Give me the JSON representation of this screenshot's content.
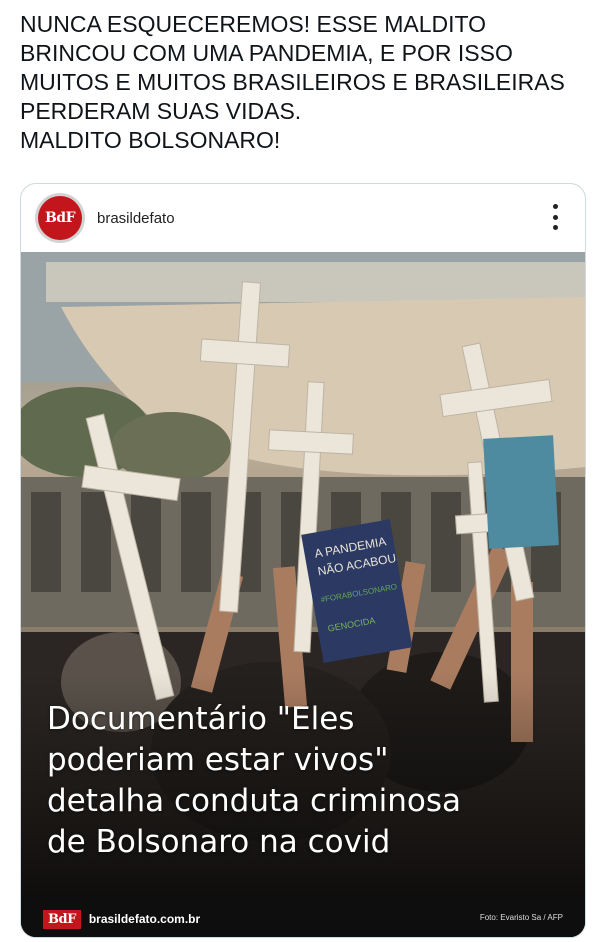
{
  "tweet": {
    "lines": [
      "NUNCA ESQUECEREMOS! ESSE MALDITO",
      "BRINCOU COM UMA PANDEMIA, E POR ISSO",
      "MUITOS E MUITOS BRASILEIROS E BRASILEIRAS",
      "PERDERAM SUAS VIDAS.",
      "MALDITO BOLSONARO!"
    ]
  },
  "embed": {
    "avatar_text": "BdF",
    "account": "brasildefato",
    "more_icon": "more-vertical-icon",
    "image": {
      "sign_lines": [
        "A PANDEMIA",
        "NÃO ACABOU",
        "#FORABOLSONARO",
        "GENOCIDA"
      ],
      "headline_lines": [
        "Documentário \"Eles",
        "poderiam estar vivos\"",
        "detalha conduta criminosa",
        "de Bolsonaro na covid"
      ],
      "footer_logo": "BdF",
      "footer_site": "brasildefato.com.br",
      "footer_credit": "Foto: Evaristo Sa / AFP"
    },
    "brand_color": "#c3161c"
  }
}
